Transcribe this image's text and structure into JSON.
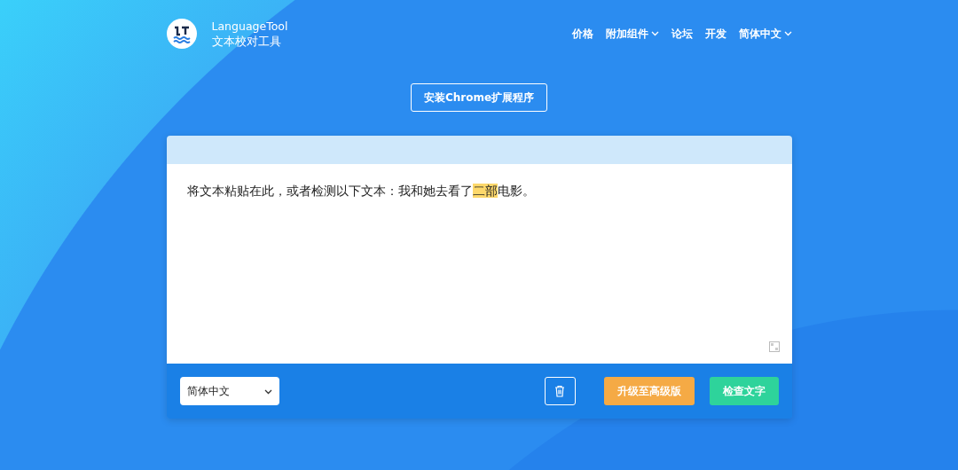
{
  "brand": {
    "name": "LanguageTool",
    "tagline": "文本校对工具"
  },
  "nav": [
    {
      "label": "价格",
      "dropdown": false
    },
    {
      "label": "附加组件",
      "dropdown": true
    },
    {
      "label": "论坛",
      "dropdown": false
    },
    {
      "label": "开发",
      "dropdown": false
    },
    {
      "label": "简体中文",
      "dropdown": true
    }
  ],
  "install_button": "安装Chrome扩展程序",
  "editor": {
    "segments": [
      {
        "text": "将文本粘贴在此，或者检测以下文本：我和她去看了",
        "highlighted": false
      },
      {
        "text": "二部",
        "highlighted": true
      },
      {
        "text": "电影。",
        "highlighted": false
      }
    ]
  },
  "language_select": {
    "value": "简体中文"
  },
  "buttons": [
    {
      "kind": "delete"
    },
    {
      "kind": "upgrade",
      "label": "升级至高级版"
    },
    {
      "kind": "check",
      "label": "检查文字"
    }
  ]
}
